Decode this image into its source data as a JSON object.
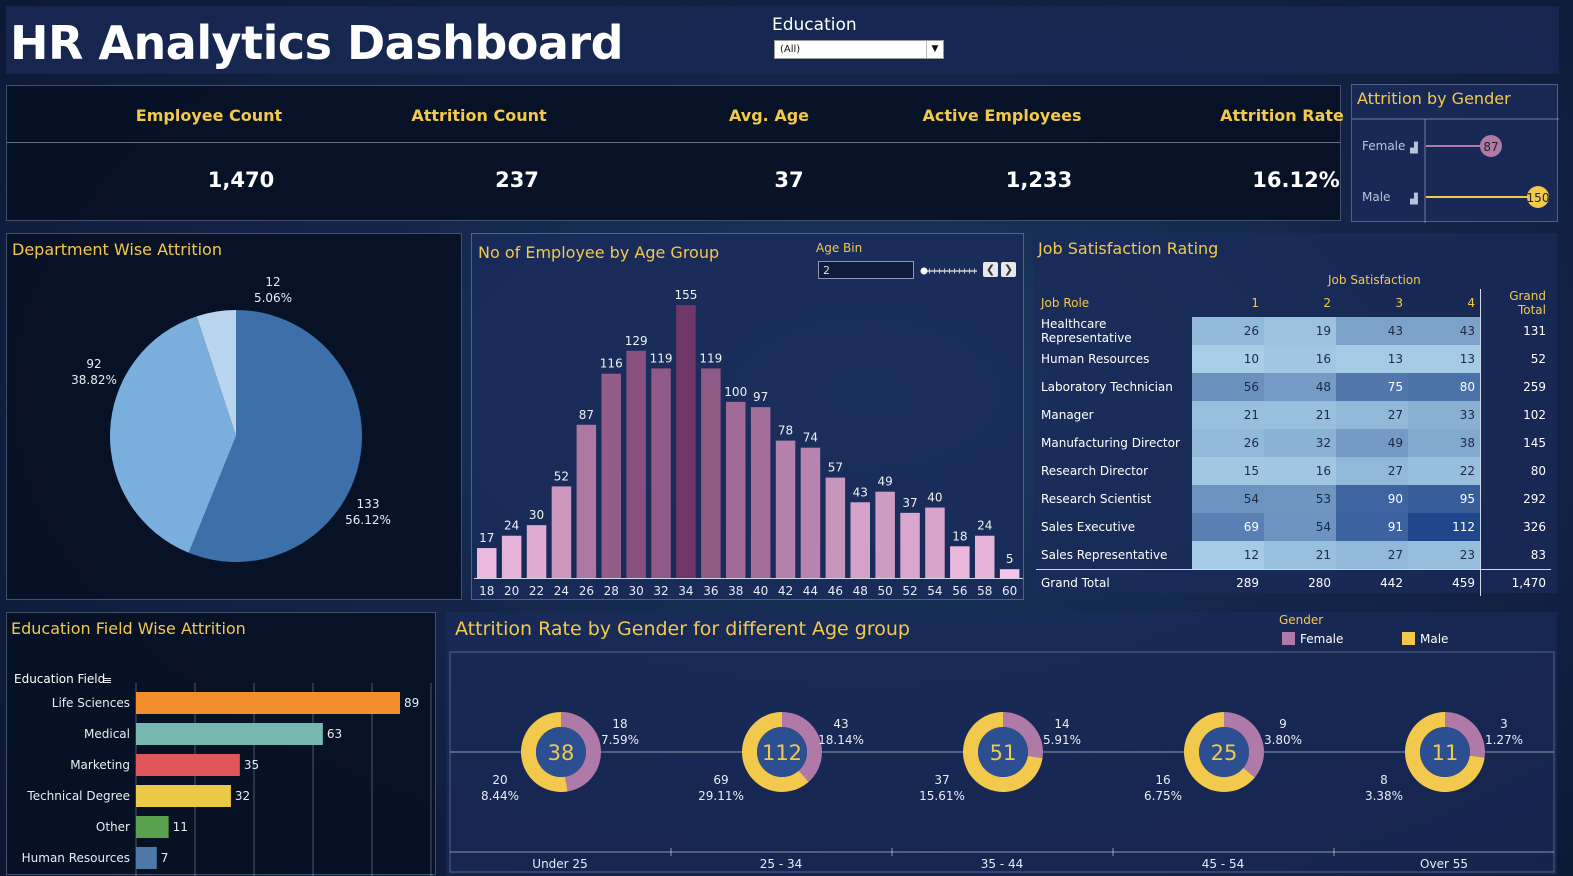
{
  "header": {
    "title": "HR Analytics Dashboard",
    "filter_label": "Education",
    "filter_value": "(All)"
  },
  "kpis": [
    {
      "label": "Employee Count",
      "value": "1,470"
    },
    {
      "label": "Attrition Count",
      "value": "237"
    },
    {
      "label": "Avg. Age",
      "value": "37"
    },
    {
      "label": "Active Employees",
      "value": "1,233"
    },
    {
      "label": "Attrition Rate",
      "value": "16.12%"
    }
  ],
  "gender_panel": {
    "title": "Attrition by Gender",
    "rows": [
      {
        "label": "Female",
        "value": 87,
        "color": "#b07aa8"
      },
      {
        "label": "Male",
        "value": 150,
        "color": "#f2c94c"
      }
    ]
  },
  "dept_panel": {
    "title": "Department Wise Attrition",
    "chart_data": {
      "type": "pie",
      "slices": [
        {
          "value": 133,
          "pct": "56.12%",
          "color": "#3d6fa8"
        },
        {
          "value": 92,
          "pct": "38.82%",
          "color": "#7aaedc"
        },
        {
          "value": 12,
          "pct": "5.06%",
          "color": "#b9d6ee"
        }
      ]
    }
  },
  "age_panel": {
    "title": "No of Employee by Age Group",
    "age_bin_label": "Age Bin",
    "age_bin_value": "2",
    "chart_data": {
      "type": "bar",
      "categories": [
        "18",
        "20",
        "22",
        "24",
        "26",
        "28",
        "30",
        "32",
        "34",
        "36",
        "38",
        "40",
        "42",
        "44",
        "46",
        "48",
        "50",
        "52",
        "54",
        "56",
        "58",
        "60"
      ],
      "values": [
        17,
        24,
        30,
        52,
        87,
        116,
        129,
        119,
        155,
        119,
        100,
        97,
        78,
        74,
        57,
        43,
        49,
        37,
        40,
        18,
        24,
        5
      ],
      "ylim": [
        0,
        155
      ]
    }
  },
  "job_panel": {
    "title": "Job Satisfaction Rating",
    "group_header": "Job Satisfaction",
    "columns": [
      "Job Role",
      "1",
      "2",
      "3",
      "4",
      "Grand Total"
    ],
    "rows": [
      {
        "role": "Healthcare Representative",
        "v": [
          26,
          19,
          43,
          43
        ],
        "total": "131"
      },
      {
        "role": "Human Resources",
        "v": [
          10,
          16,
          13,
          13
        ],
        "total": "52"
      },
      {
        "role": "Laboratory Technician",
        "v": [
          56,
          48,
          75,
          80
        ],
        "total": "259"
      },
      {
        "role": "Manager",
        "v": [
          21,
          21,
          27,
          33
        ],
        "total": "102"
      },
      {
        "role": "Manufacturing Director",
        "v": [
          26,
          32,
          49,
          38
        ],
        "total": "145"
      },
      {
        "role": "Research Director",
        "v": [
          15,
          16,
          27,
          22
        ],
        "total": "80"
      },
      {
        "role": "Research Scientist",
        "v": [
          54,
          53,
          90,
          95
        ],
        "total": "292"
      },
      {
        "role": "Sales Executive",
        "v": [
          69,
          54,
          91,
          112
        ],
        "total": "326"
      },
      {
        "role": "Sales Representative",
        "v": [
          12,
          21,
          27,
          23
        ],
        "total": "83"
      }
    ],
    "grand_total": {
      "label": "Grand Total",
      "v": [
        "289",
        "280",
        "442",
        "459"
      ],
      "total": "1,470"
    }
  },
  "edu_panel": {
    "title": "Education Field Wise Attrition",
    "axis_label": "Education Field",
    "chart_data": {
      "type": "bar",
      "categories": [
        "Life Sciences",
        "Medical",
        "Marketing",
        "Technical Degree",
        "Other",
        "Human Resources"
      ],
      "values": [
        89,
        63,
        35,
        32,
        11,
        7
      ],
      "colors": [
        "#f28e2b",
        "#76b7b2",
        "#e15759",
        "#edc948",
        "#59a14f",
        "#4e79a7"
      ]
    }
  },
  "ag_panel": {
    "title": "Attrition Rate by Gender for different Age group",
    "legend_title": "Gender",
    "legend": [
      {
        "name": "Female",
        "color": "#b07aa8"
      },
      {
        "name": "Male",
        "color": "#f2c94c"
      }
    ],
    "chart_data": {
      "type": "pie",
      "groups": [
        {
          "label": "Under 25",
          "total": 38,
          "female": 18,
          "female_pct": "7.59%",
          "male": 20,
          "male_pct": "8.44%"
        },
        {
          "label": "25 - 34",
          "total": 112,
          "female": 43,
          "female_pct": "18.14%",
          "male": 69,
          "male_pct": "29.11%"
        },
        {
          "label": "35 - 44",
          "total": 51,
          "female": 14,
          "female_pct": "5.91%",
          "male": 37,
          "male_pct": "15.61%"
        },
        {
          "label": "45 - 54",
          "total": 25,
          "female": 9,
          "female_pct": "3.80%",
          "male": 16,
          "male_pct": "6.75%"
        },
        {
          "label": "Over 55",
          "total": 11,
          "female": 3,
          "female_pct": "1.27%",
          "male": 8,
          "male_pct": "3.38%"
        }
      ]
    }
  }
}
